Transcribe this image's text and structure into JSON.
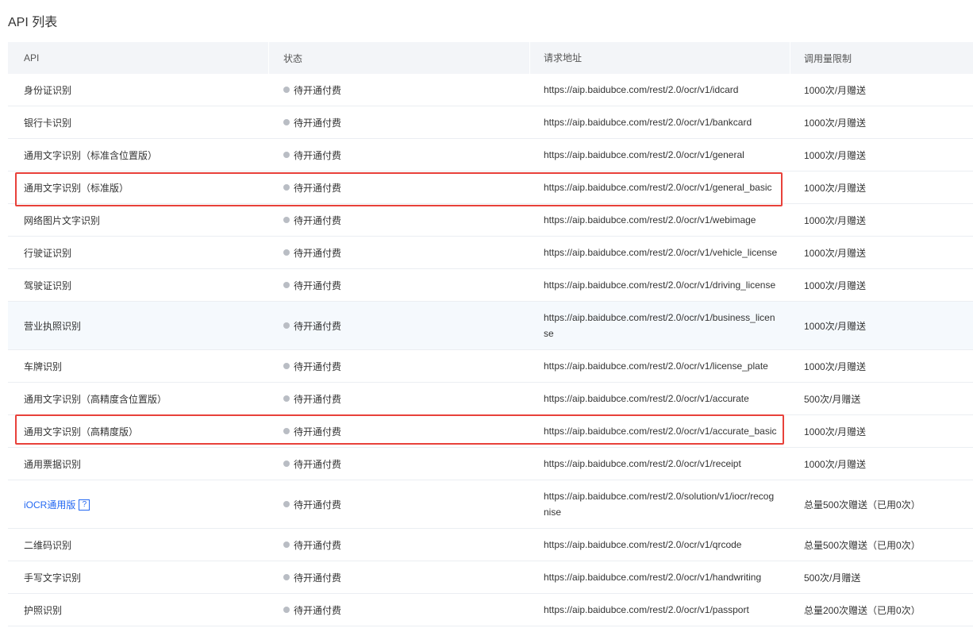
{
  "page": {
    "title": "API 列表"
  },
  "table": {
    "headers": {
      "api": "API",
      "status": "状态",
      "url": "请求地址",
      "limit": "调用量限制"
    },
    "rows": [
      {
        "api": "身份证识别",
        "status": "待开通付费",
        "url": "https://aip.baidubce.com/rest/2.0/ocr/v1/idcard",
        "limit": "1000次/月赠送"
      },
      {
        "api": "银行卡识别",
        "status": "待开通付费",
        "url": "https://aip.baidubce.com/rest/2.0/ocr/v1/bankcard",
        "limit": "1000次/月赠送"
      },
      {
        "api": "通用文字识别（标准含位置版）",
        "status": "待开通付费",
        "url": "https://aip.baidubce.com/rest/2.0/ocr/v1/general",
        "limit": "1000次/月赠送"
      },
      {
        "api": "通用文字识别（标准版）",
        "status": "待开通付费",
        "url": "https://aip.baidubce.com/rest/2.0/ocr/v1/general_basic",
        "limit": "1000次/月赠送"
      },
      {
        "api": "网络图片文字识别",
        "status": "待开通付费",
        "url": "https://aip.baidubce.com/rest/2.0/ocr/v1/webimage",
        "limit": "1000次/月赠送"
      },
      {
        "api": "行驶证识别",
        "status": "待开通付费",
        "url": "https://aip.baidubce.com/rest/2.0/ocr/v1/vehicle_license",
        "limit": "1000次/月赠送"
      },
      {
        "api": "驾驶证识别",
        "status": "待开通付费",
        "url": "https://aip.baidubce.com/rest/2.0/ocr/v1/driving_license",
        "limit": "1000次/月赠送"
      },
      {
        "api": "营业执照识别",
        "status": "待开通付费",
        "url": "https://aip.baidubce.com/rest/2.0/ocr/v1/business_license",
        "limit": "1000次/月赠送"
      },
      {
        "api": "车牌识别",
        "status": "待开通付费",
        "url": "https://aip.baidubce.com/rest/2.0/ocr/v1/license_plate",
        "limit": "1000次/月赠送"
      },
      {
        "api": "通用文字识别（高精度含位置版）",
        "status": "待开通付费",
        "url": "https://aip.baidubce.com/rest/2.0/ocr/v1/accurate",
        "limit": "500次/月赠送"
      },
      {
        "api": "通用文字识别（高精度版）",
        "status": "待开通付费",
        "url": "https://aip.baidubce.com/rest/2.0/ocr/v1/accurate_basic",
        "limit": "1000次/月赠送"
      },
      {
        "api": "通用票据识别",
        "status": "待开通付费",
        "url": "https://aip.baidubce.com/rest/2.0/ocr/v1/receipt",
        "limit": "1000次/月赠送"
      },
      {
        "api": "iOCR通用版",
        "help": "?",
        "status": "待开通付费",
        "url": "https://aip.baidubce.com/rest/2.0/solution/v1/iocr/recognise",
        "limit": "总量500次赠送（已用0次）"
      },
      {
        "api": "二维码识别",
        "status": "待开通付费",
        "url": "https://aip.baidubce.com/rest/2.0/ocr/v1/qrcode",
        "limit": "总量500次赠送（已用0次）"
      },
      {
        "api": "手写文字识别",
        "status": "待开通付费",
        "url": "https://aip.baidubce.com/rest/2.0/ocr/v1/handwriting",
        "limit": "500次/月赠送"
      },
      {
        "api": "护照识别",
        "status": "待开通付费",
        "url": "https://aip.baidubce.com/rest/2.0/ocr/v1/passport",
        "limit": "总量200次赠送（已用0次）"
      }
    ]
  },
  "colors": {
    "link": "#2468f2",
    "highlight": "#e8413a",
    "status_dot": "#b9bdc4",
    "header_bg": "#f3f5f8"
  }
}
